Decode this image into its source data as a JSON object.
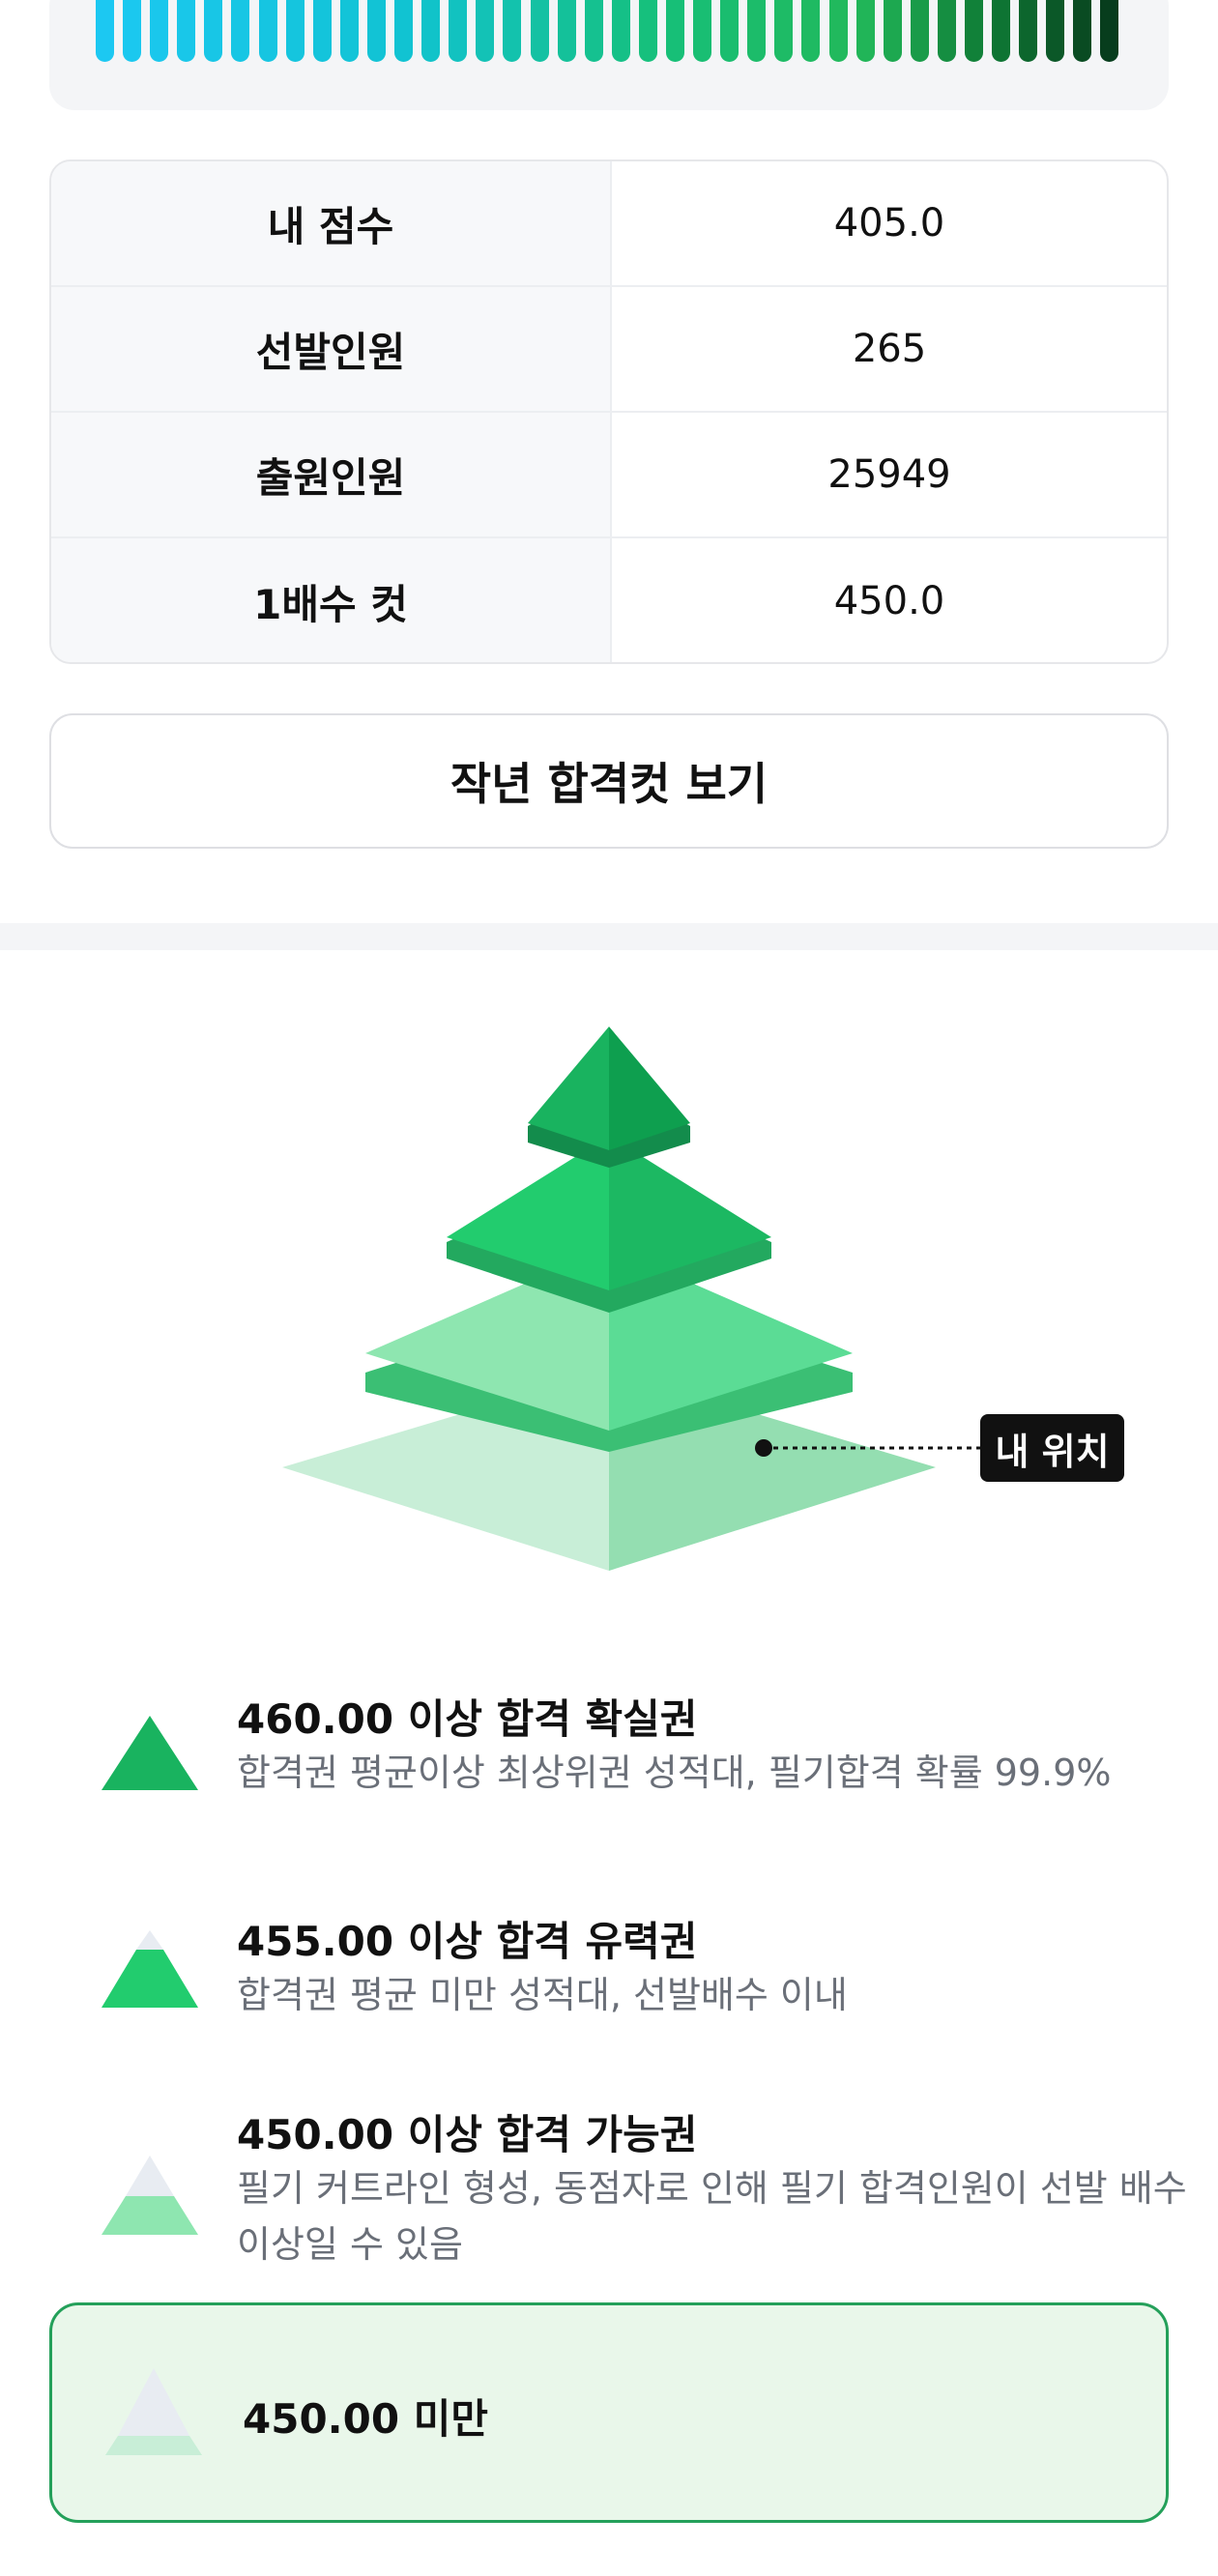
{
  "score_table": {
    "rows": [
      {
        "label": "내 점수",
        "value": "405.0"
      },
      {
        "label": "선발인원",
        "value": "265"
      },
      {
        "label": "출원인원",
        "value": "25949"
      },
      {
        "label": "1배수 컷",
        "value": "450.0"
      }
    ]
  },
  "prev_cut_button": "작년 합격컷 보기",
  "pyramid": {
    "my_position_label": "내 위치",
    "colors": {
      "tier1": "#19b35f",
      "tier2": "#22cc6e",
      "tier3": "#8ee6b0",
      "tier4": "#c8eed7"
    }
  },
  "legend": [
    {
      "title": "460.00 이상 합격 확실권",
      "desc": "합격권 평균이상 최상위권 성적대, 필기합격 확률 99.9%",
      "icon": "pyramid-top-icon"
    },
    {
      "title": "455.00 이상 합격 유력권",
      "desc": "합격권 평균 미만 성적대, 선발배수 이내",
      "icon": "pyramid-mid-icon"
    },
    {
      "title": "450.00 이상 합격 가능권",
      "desc": "필기 커트라인 형성, 동점자로 인해 필기 합격인원이 선발 배수 이상일 수 있음",
      "icon": "pyramid-low-icon"
    }
  ],
  "current_range": {
    "title": "450.00 미만",
    "icon": "pyramid-base-icon"
  }
}
